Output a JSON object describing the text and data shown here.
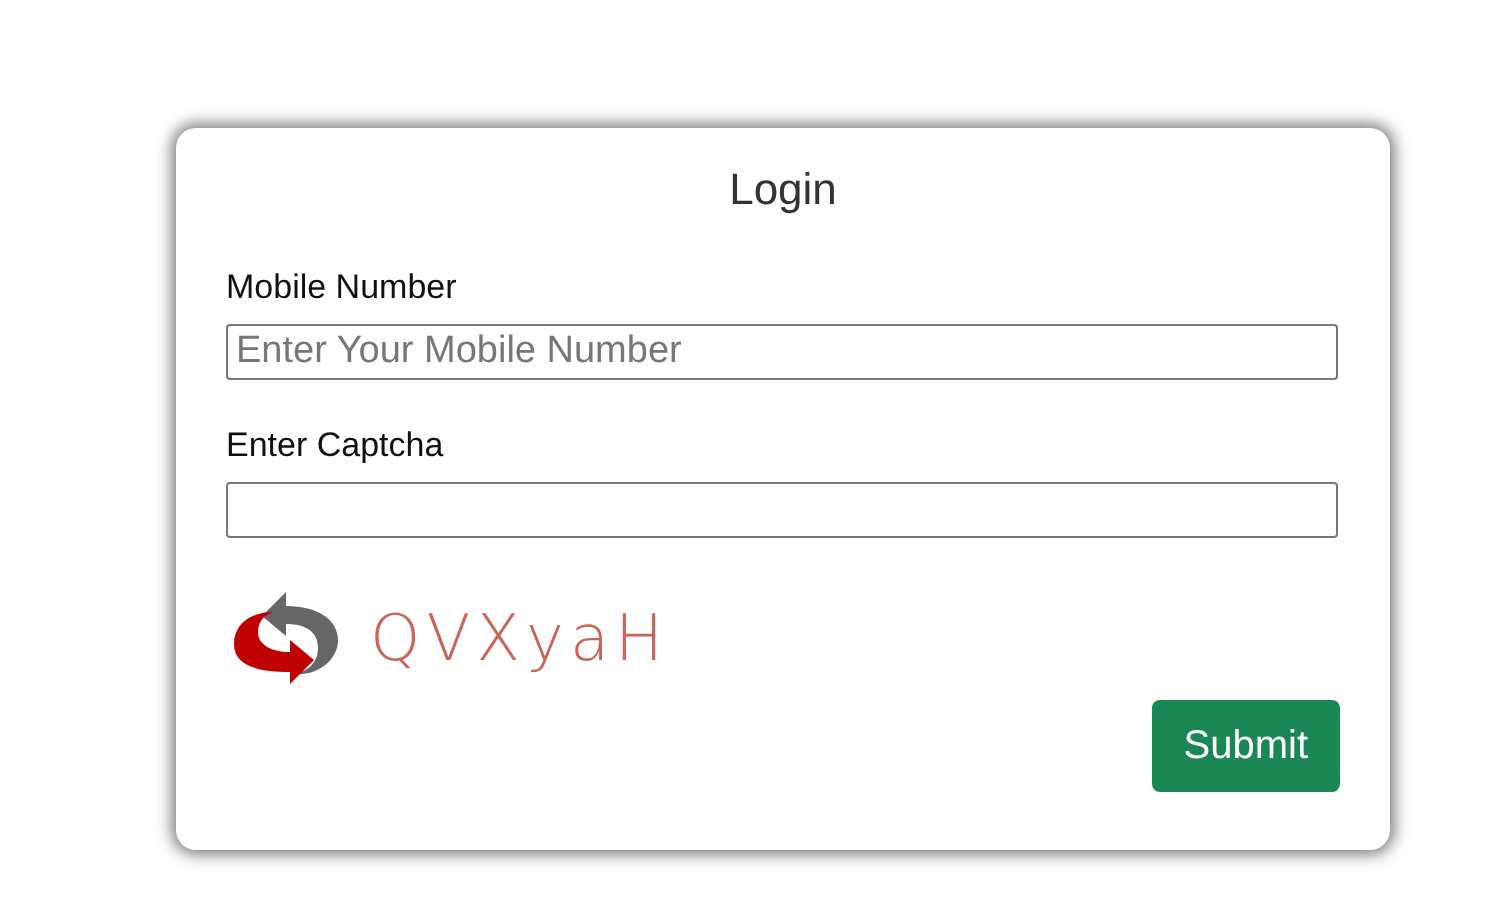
{
  "form": {
    "title": "Login",
    "fields": [
      {
        "label": "Mobile Number",
        "placeholder": "Enter Your Mobile Number"
      },
      {
        "label": "Enter Captcha"
      }
    ],
    "captcha": {
      "text": "QVXyaH"
    },
    "submit": "Submit"
  }
}
